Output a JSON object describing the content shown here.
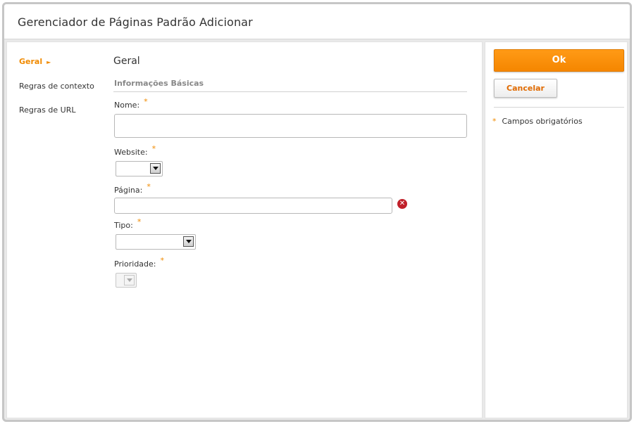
{
  "window": {
    "title": "Gerenciador de Páginas Padrão Adicionar"
  },
  "nav": {
    "items": [
      {
        "label": "Geral",
        "active": true
      },
      {
        "label": "Regras de contexto",
        "active": false
      },
      {
        "label": "Regras de URL",
        "active": false
      }
    ],
    "active_arrow": "►"
  },
  "form": {
    "section_title": "Geral",
    "group_title": "Informações Básicas",
    "required_mark": "*",
    "fields": {
      "nome": {
        "label": "Nome:",
        "value": ""
      },
      "website": {
        "label": "Website:",
        "value": ""
      },
      "pagina": {
        "label": "Página:",
        "value": ""
      },
      "tipo": {
        "label": "Tipo:",
        "value": ""
      },
      "prioridade": {
        "label": "Prioridade:",
        "value": ""
      }
    }
  },
  "actions": {
    "ok_label": "Ok",
    "cancel_label": "Cancelar",
    "required_note": "Campos obrigatórios"
  },
  "colors": {
    "accent": "#f08a00",
    "ok_button": "#f58600",
    "error_icon": "#c0202a"
  }
}
